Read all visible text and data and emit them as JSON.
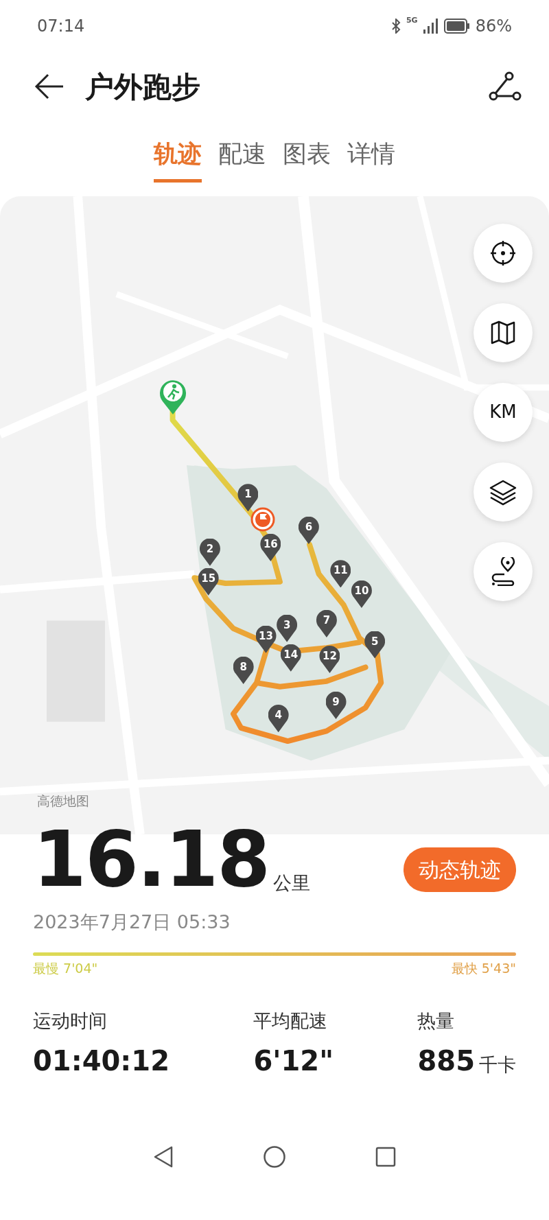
{
  "status_bar": {
    "time": "07:14",
    "network": "5G",
    "battery": "86%"
  },
  "header": {
    "title": "户外跑步"
  },
  "tabs": [
    {
      "label": "轨迹",
      "selected": true
    },
    {
      "label": "配速",
      "selected": false
    },
    {
      "label": "图表",
      "selected": false
    },
    {
      "label": "详情",
      "selected": false
    }
  ],
  "map": {
    "kind": "picture",
    "controls": [
      {
        "kind": "locate"
      },
      {
        "kind": "map"
      },
      {
        "kind": "units",
        "label": "KM"
      },
      {
        "kind": "layers"
      },
      {
        "kind": "route"
      }
    ],
    "km_markers": [
      "1",
      "2",
      "3",
      "4",
      "5",
      "6",
      "7",
      "8",
      "9",
      "10",
      "11",
      "12",
      "13",
      "14",
      "15",
      "16"
    ],
    "attribution": "高德地图"
  },
  "summary": {
    "distance": "16.18",
    "unit": "公里",
    "button": "动态轨迹",
    "date": "2023年7月27日 05:33"
  },
  "pace_range": {
    "slowest": "最慢 7'04\"",
    "fastest": "最快 5'43\""
  },
  "stats": [
    {
      "label": "运动时间",
      "value": "01:40:12"
    },
    {
      "label": "平均配速",
      "value": "6'12\""
    },
    {
      "label": "热量",
      "value": "885",
      "unit": "千卡"
    }
  ]
}
